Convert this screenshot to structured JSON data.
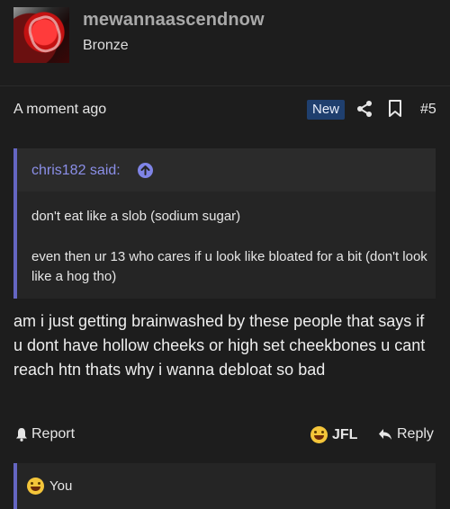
{
  "user": {
    "name": "mewannaascendnow",
    "rank": "Bronze"
  },
  "meta": {
    "time": "A moment ago",
    "badge": "New",
    "post_number": "#5"
  },
  "quote": {
    "author": "chris182 said:",
    "paragraphs": [
      "don't eat like a slob (sodium sugar)",
      "even then ur 13 who cares if u look like bloated for a bit (don't look like a hog tho)"
    ]
  },
  "message": "am i just getting brainwashed by these people that says if u dont have hollow cheeks or high set cheekbones u cant reach htn thats why i wanna debloat so bad",
  "actions": {
    "report": "Report",
    "reaction": "JFL",
    "reply": "Reply"
  },
  "reactions_bar": {
    "label": "You"
  },
  "icons": [
    "avatar",
    "share-icon",
    "bookmark-icon",
    "quote-up-icon",
    "bell-icon",
    "laugh-cry-emoji",
    "reply-arrow-icon"
  ],
  "colors": {
    "accent": "#6566c2",
    "quote_author": "#8b8fe8",
    "badge_bg": "#1f3f6e",
    "background": "#1d1d1d"
  }
}
